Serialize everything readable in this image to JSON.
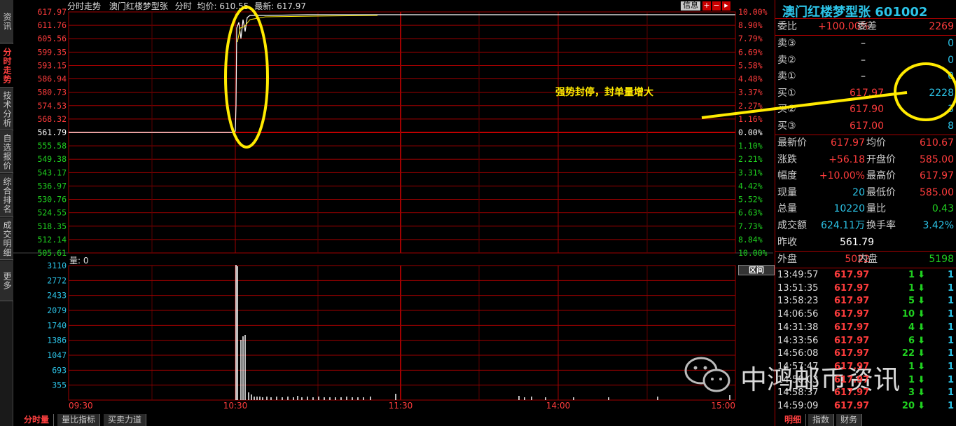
{
  "side_tabs": [
    {
      "label": "资讯",
      "active": false
    },
    {
      "label": "分时走势",
      "active": true
    },
    {
      "label": "技术分析",
      "active": false
    },
    {
      "label": "自选报价",
      "active": false
    },
    {
      "label": "综合排名",
      "active": false
    },
    {
      "label": "成交明细",
      "active": false
    },
    {
      "label": "更多",
      "active": false
    }
  ],
  "chart_header": {
    "title": "分时走势",
    "stock": "澳门红楼梦型张",
    "mode": "分时",
    "avg_label": "均价: 610.55",
    "latest_label": "最新: 617.97",
    "info_button": "信息"
  },
  "volume_header": {
    "label": "量: 0"
  },
  "interval_button": "区间",
  "annotation": "强势封停，封单量增大",
  "watermark": "中鸿邮币资讯",
  "bottom_tabs": [
    "分时量",
    "量比指标",
    "买卖力道"
  ],
  "right_bottom_tabs": [
    "明细",
    "指数",
    "财务"
  ],
  "price_labels": [
    {
      "price": "617.97",
      "pct": "10.00%",
      "color": "red"
    },
    {
      "price": "611.76",
      "pct": "8.90%",
      "color": "red"
    },
    {
      "price": "605.56",
      "pct": "7.79%",
      "color": "red"
    },
    {
      "price": "599.35",
      "pct": "6.69%",
      "color": "red"
    },
    {
      "price": "593.15",
      "pct": "5.58%",
      "color": "red"
    },
    {
      "price": "586.94",
      "pct": "4.48%",
      "color": "red"
    },
    {
      "price": "580.73",
      "pct": "3.37%",
      "color": "red"
    },
    {
      "price": "574.53",
      "pct": "2.27%",
      "color": "red"
    },
    {
      "price": "568.32",
      "pct": "1.16%",
      "color": "red"
    },
    {
      "price": "561.79",
      "pct": "0.00%",
      "color": "white"
    },
    {
      "price": "555.58",
      "pct": "1.10%",
      "color": "green"
    },
    {
      "price": "549.38",
      "pct": "2.21%",
      "color": "green"
    },
    {
      "price": "543.17",
      "pct": "3.31%",
      "color": "green"
    },
    {
      "price": "536.97",
      "pct": "4.42%",
      "color": "green"
    },
    {
      "price": "530.76",
      "pct": "5.52%",
      "color": "green"
    },
    {
      "price": "524.55",
      "pct": "6.63%",
      "color": "green"
    },
    {
      "price": "518.35",
      "pct": "7.73%",
      "color": "green"
    },
    {
      "price": "512.14",
      "pct": "8.84%",
      "color": "green"
    },
    {
      "price": "505.61",
      "pct": "10.00%",
      "color": "green"
    }
  ],
  "volume_labels": [
    "3110",
    "2772",
    "2433",
    "2079",
    "1740",
    "1386",
    "1047",
    "693",
    "355"
  ],
  "time_labels": [
    "09:30",
    "10:30",
    "11:30",
    "14:00",
    "15:00"
  ],
  "quote": {
    "name": "澳门红楼梦型张",
    "code": "601002",
    "weibi_label": "委比",
    "weibi": "+100.00%",
    "weicha_label": "委差",
    "weicha": "2269",
    "sell": [
      {
        "label": "卖③",
        "price": "–",
        "vol": "0"
      },
      {
        "label": "卖②",
        "price": "–",
        "vol": "0"
      },
      {
        "label": "卖①",
        "price": "–",
        "vol": "0"
      }
    ],
    "buy": [
      {
        "label": "买①",
        "price": "617.97",
        "vol": "2228"
      },
      {
        "label": "买②",
        "price": "617.90",
        "vol": "3"
      },
      {
        "label": "买③",
        "price": "617.00",
        "vol": "8"
      }
    ],
    "stats": [
      {
        "l1": "最新价",
        "v1": "617.97",
        "c1": "red",
        "l2": "均价",
        "v2": "610.67",
        "c2": "red"
      },
      {
        "l1": "涨跌",
        "v1": "+56.18",
        "c1": "red",
        "l2": "开盘价",
        "v2": "585.00",
        "c2": "red"
      },
      {
        "l1": "幅度",
        "v1": "+10.00%",
        "c1": "red",
        "l2": "最高价",
        "v2": "617.97",
        "c2": "red"
      },
      {
        "l1": "现量",
        "v1": "20",
        "c1": "cyan",
        "l2": "最低价",
        "v2": "585.00",
        "c2": "red"
      },
      {
        "l1": "总量",
        "v1": "10220",
        "c1": "cyan",
        "l2": "量比",
        "v2": "0.43",
        "c2": "green"
      },
      {
        "l1": "成交额",
        "v1": "624.11万",
        "c1": "cyan",
        "l2": "换手率",
        "v2": "3.42%",
        "c2": "cyan"
      },
      {
        "l1": "昨收",
        "v1": "561.79",
        "c1": "white",
        "l2": "",
        "v2": "",
        "c2": "white"
      }
    ],
    "outer_label": "外盘",
    "outer": "5022",
    "inner_label": "内盘",
    "inner": "5198"
  },
  "ticks": [
    {
      "time": "13:49:57",
      "price": "617.97",
      "vol": "1",
      "count": "1"
    },
    {
      "time": "13:51:35",
      "price": "617.97",
      "vol": "1",
      "count": "1"
    },
    {
      "time": "13:58:23",
      "price": "617.97",
      "vol": "5",
      "count": "1"
    },
    {
      "time": "14:06:56",
      "price": "617.97",
      "vol": "10",
      "count": "1"
    },
    {
      "time": "14:31:38",
      "price": "617.97",
      "vol": "4",
      "count": "1"
    },
    {
      "time": "14:33:56",
      "price": "617.97",
      "vol": "6",
      "count": "1"
    },
    {
      "time": "14:56:08",
      "price": "617.97",
      "vol": "22",
      "count": "1"
    },
    {
      "time": "14:57:47",
      "price": "617.97",
      "vol": "1",
      "count": "1"
    },
    {
      "time": "14:58:03",
      "price": "617.97",
      "vol": "1",
      "count": "1"
    },
    {
      "time": "14:58:37",
      "price": "617.97",
      "vol": "3",
      "count": "1"
    },
    {
      "time": "14:59:09",
      "price": "617.97",
      "vol": "20",
      "count": "1"
    }
  ],
  "colors": {
    "up": "#ff3c3c",
    "down": "#20d020",
    "grid": "#a00000",
    "accent": "#2cc4e8",
    "mark": "#ffea00"
  }
}
